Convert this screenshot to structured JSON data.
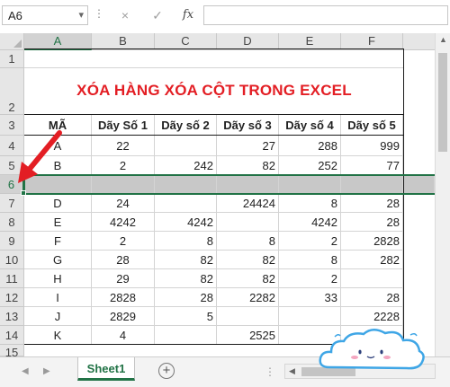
{
  "formula_bar": {
    "name_box": "A6",
    "dots": "⋮",
    "cancel_icon": "×",
    "enter_icon": "✓",
    "fx_label": "fx",
    "formula": ""
  },
  "columns": [
    "A",
    "B",
    "C",
    "D",
    "E",
    "F"
  ],
  "rows": [
    "1",
    "2",
    "3",
    "4",
    "5",
    "6",
    "7",
    "8",
    "9",
    "10",
    "11",
    "12",
    "13",
    "14",
    "15"
  ],
  "title": "XÓA HÀNG XÓA CỘT TRONG EXCEL",
  "headers": [
    "MÃ",
    "Dãy Số 1",
    "Dãy số 2",
    "Dãy số 3",
    "Dãy số 4",
    "Dãy số 5"
  ],
  "table": [
    [
      "A",
      "22",
      "",
      "27",
      "288",
      "999"
    ],
    [
      "B",
      "2",
      "242",
      "82",
      "252",
      "77"
    ],
    [
      "",
      "",
      "",
      "",
      "",
      ""
    ],
    [
      "D",
      "24",
      "",
      "24424",
      "8",
      "28"
    ],
    [
      "E",
      "4242",
      "4242",
      "",
      "4242",
      "28"
    ],
    [
      "F",
      "2",
      "8",
      "8",
      "2",
      "2828"
    ],
    [
      "G",
      "28",
      "82",
      "82",
      "8",
      "282"
    ],
    [
      "H",
      "29",
      "82",
      "82",
      "2",
      ""
    ],
    [
      "I",
      "2828",
      "28",
      "2282",
      "33",
      "28"
    ],
    [
      "J",
      "2829",
      "5",
      "",
      "",
      "2228"
    ],
    [
      "K",
      "4",
      "",
      "2525",
      "",
      ""
    ]
  ],
  "selected_row": "6",
  "sheet_tabs": [
    "Sheet1"
  ],
  "add_sheet": "+",
  "colors": {
    "accent": "#217346",
    "title": "#e31e24",
    "selected_row_fill": "#c8c8c8",
    "arrow": "#e31e24"
  }
}
